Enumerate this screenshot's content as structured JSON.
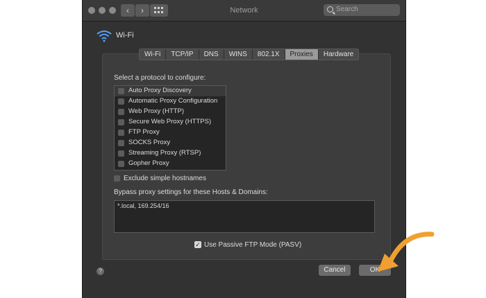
{
  "window": {
    "title": "Network"
  },
  "search": {
    "placeholder": "Search"
  },
  "nav": {
    "back": "‹",
    "forward": "›"
  },
  "interface": {
    "name": "Wi-Fi"
  },
  "tabs": [
    "Wi-Fi",
    "TCP/IP",
    "DNS",
    "WINS",
    "802.1X",
    "Proxies",
    "Hardware"
  ],
  "active_tab": "Proxies",
  "protocol_prompt": "Select a protocol to configure:",
  "protocols": [
    "Auto Proxy Discovery",
    "Automatic Proxy Configuration",
    "Web Proxy (HTTP)",
    "Secure Web Proxy (HTTPS)",
    "FTP Proxy",
    "SOCKS Proxy",
    "Streaming Proxy (RTSP)",
    "Gopher Proxy"
  ],
  "exclude_label": "Exclude simple hostnames",
  "bypass_label": "Bypass proxy settings for these Hosts & Domains:",
  "bypass_value": "*.local, 169.254/16",
  "pasv_label": "Use Passive FTP Mode (PASV)",
  "pasv_checked": true,
  "help_label": "?",
  "buttons": {
    "cancel": "Cancel",
    "ok": "OK"
  },
  "colors": {
    "arrow": "#f0a030",
    "window_bg": "#323232"
  }
}
